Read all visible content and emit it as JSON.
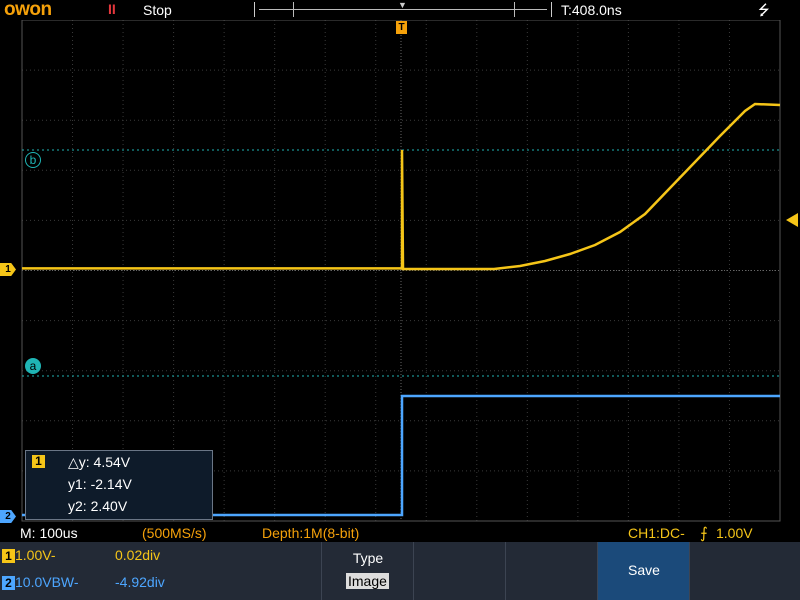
{
  "header": {
    "logo": "owon",
    "run_indicator": "II",
    "run_state": "Stop",
    "trigger_time": "T:408.0ns",
    "usb_icon": "usb-icon"
  },
  "screen": {
    "trigger_marker": "T",
    "cursor_b_label": "b",
    "cursor_a_label": "a",
    "ch1_marker": "1",
    "ch2_marker": "2"
  },
  "readout": {
    "channel": "1",
    "delta_y": "△y: 4.54V",
    "y1": "y1: -2.14V",
    "y2": "y2: 2.40V"
  },
  "status": {
    "timebase": "M: 100us",
    "sample_rate": "(500MS/s)",
    "depth": "Depth:1M(8-bit)",
    "trigger": "CH1:DC- ",
    "trigger_level": "1.00V",
    "trigger_edge_icon": "rising-edge-icon"
  },
  "channels": [
    {
      "badge": "1",
      "scale": "1.00V-",
      "offset": "0.02div",
      "color": "#f5c518"
    },
    {
      "badge": "2",
      "scale": "10.0VBW-",
      "offset": "-4.92div",
      "color": "#4da6ff"
    }
  ],
  "menu": {
    "type_label": "Type",
    "type_value": "Image",
    "save_label": "Save"
  },
  "colors": {
    "ch1": "#f5c518",
    "ch2": "#4da6ff",
    "cursor": "#1fb5b5",
    "logo": "#f5a10a",
    "menu_bg": "#232a36",
    "selected": "#1b4a7a"
  }
}
